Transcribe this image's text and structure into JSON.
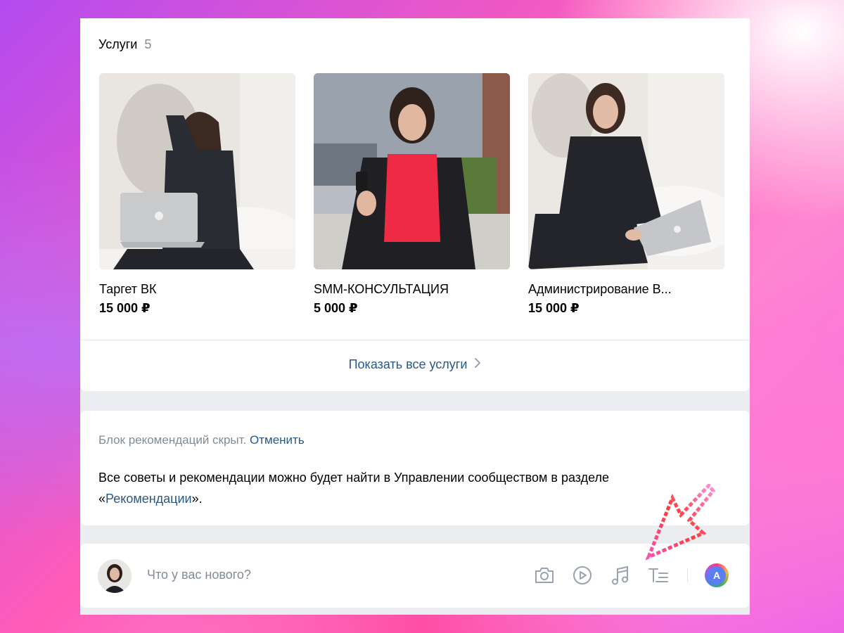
{
  "services": {
    "title": "Услуги",
    "count": "5",
    "items": [
      {
        "title": "Таргет ВК",
        "price": "15 000 ₽"
      },
      {
        "title": "SMM-КОНСУЛЬТАЦИЯ",
        "price": "5 000 ₽"
      },
      {
        "title": "Администрирование В...",
        "price": "15 000 ₽"
      }
    ],
    "show_all": "Показать все услуги"
  },
  "recommendations": {
    "hidden_note": "Блок рекомендаций скрыт.",
    "undo": "Отменить",
    "text_before": "Все советы и рекомендации можно будет найти в Управлении сообществом в разделе «",
    "link": "Рекомендации",
    "text_after": "»."
  },
  "post": {
    "placeholder": "Что у вас нового?",
    "author_initial": "А",
    "icons": [
      "camera-icon",
      "video-icon",
      "music-icon",
      "text-format-icon"
    ]
  },
  "colors": {
    "link": "#2a5885",
    "muted": "#818c99",
    "background": "#ebedf0"
  }
}
